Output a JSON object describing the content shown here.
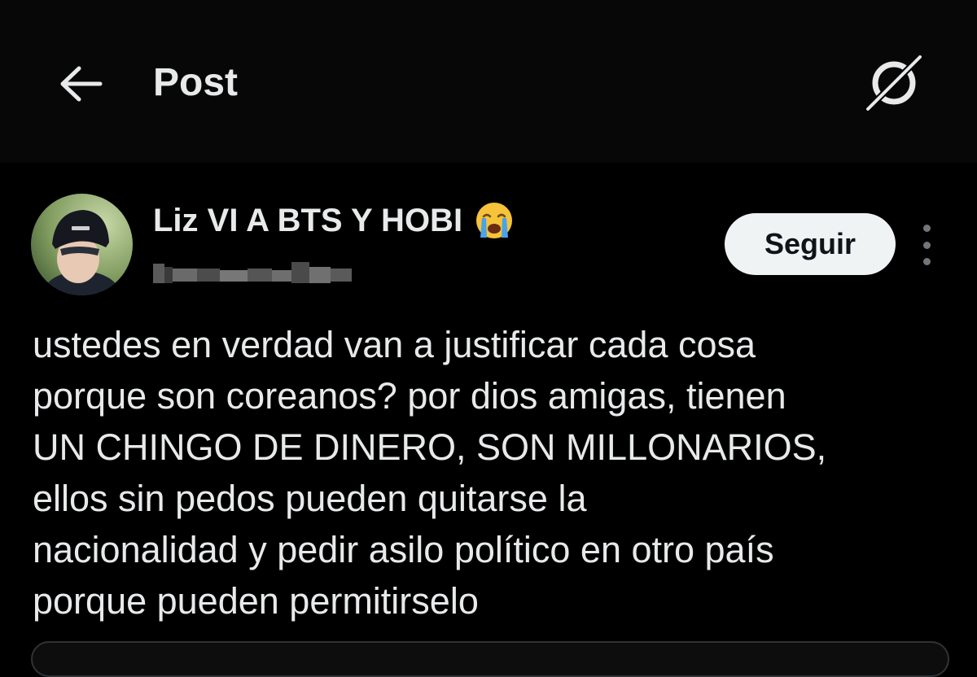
{
  "header": {
    "title": "Post",
    "back_icon": "back-arrow-icon",
    "grok_icon": "grok-icon"
  },
  "post": {
    "author": {
      "display_name": "Liz VI A BTS Y HOBI",
      "emoji": "loudly-crying-face",
      "handle": ""
    },
    "follow_label": "Seguir",
    "text": "ustedes en verdad van a justificar cada cosa\nporque son coreanos? por dios amigas, tienen\nUN CHINGO DE DINERO, SON MILLONARIOS,\nellos sin pedos pueden quitarse la\nnacionalidad y pedir asilo político en otro país\nporque pueden permitirselo"
  },
  "colors": {
    "background": "#000000",
    "text": "#e7e9ea",
    "secondary": "#71767b",
    "follow_bg": "#eff3f4",
    "follow_text": "#0f1419"
  }
}
